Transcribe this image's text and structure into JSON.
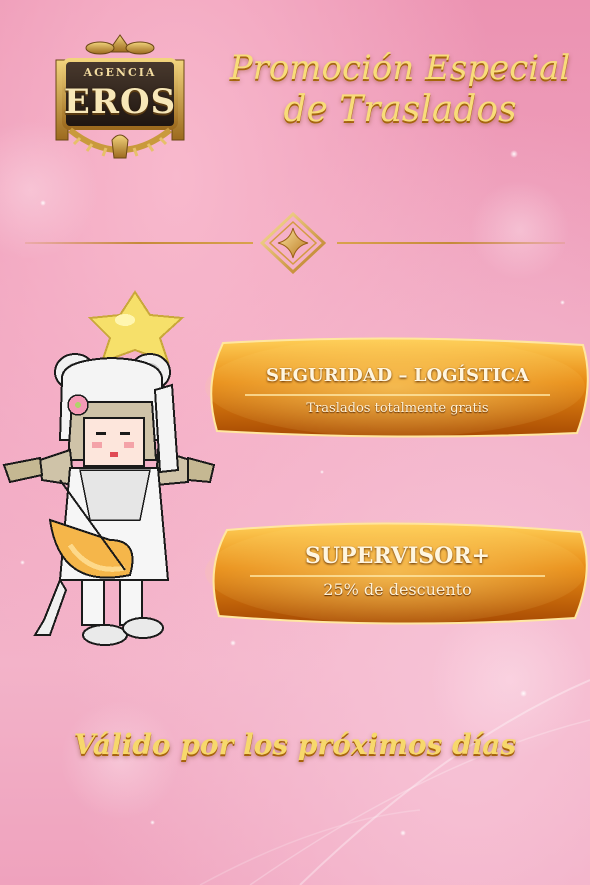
{
  "logo": {
    "top_text": "AGENCIA",
    "main_text": "EROS"
  },
  "title": {
    "line1": "Promoción Especial",
    "line2": "de Traslados"
  },
  "banners": [
    {
      "label": "SEGURIDAD – LOGÍSTICA",
      "sub": "Traslados totalmente gratis"
    },
    {
      "label": "SUPERVISOR+",
      "sub": "25% de descuento"
    }
  ],
  "footer": "Válido por los próximos días",
  "colors": {
    "gold": "#f8dc7a",
    "gold_dark": "#a5660d",
    "banner_orange": "#e88a12",
    "pink_bg": "#f0a4bf"
  },
  "icons": [
    "laurel-logo-icon",
    "gold-diamond-star-icon",
    "pixel-star-icon",
    "pixel-avatar"
  ]
}
